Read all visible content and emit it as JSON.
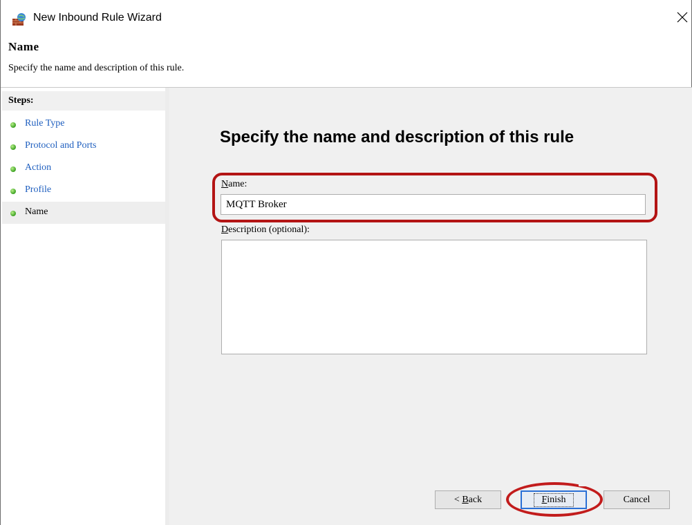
{
  "window": {
    "title": "New Inbound Rule Wizard",
    "close_icon": "close-icon"
  },
  "header": {
    "title": "Name",
    "subtitle": "Specify the name and description of this rule."
  },
  "steps": {
    "heading": "Steps:",
    "items": [
      {
        "label": "Rule Type"
      },
      {
        "label": "Protocol and Ports"
      },
      {
        "label": "Action"
      },
      {
        "label": "Profile"
      },
      {
        "label": "Name"
      }
    ],
    "active_index": 4
  },
  "main": {
    "heading": "Specify the name and description of this rule",
    "name_label_rest": "ame:",
    "name_label_accel": "N",
    "name_value": "MQTT Broker",
    "desc_label_accel": "D",
    "desc_label_rest": "escription (optional):",
    "desc_value": ""
  },
  "buttons": {
    "back_prefix": "< ",
    "back_accel": "B",
    "back_rest": "ack",
    "finish_accel": "F",
    "finish_rest": "inish",
    "cancel": "Cancel"
  },
  "colors": {
    "highlight": "#b31414",
    "link": "#1f5fbf",
    "panel_bg": "#f0f0f0"
  }
}
